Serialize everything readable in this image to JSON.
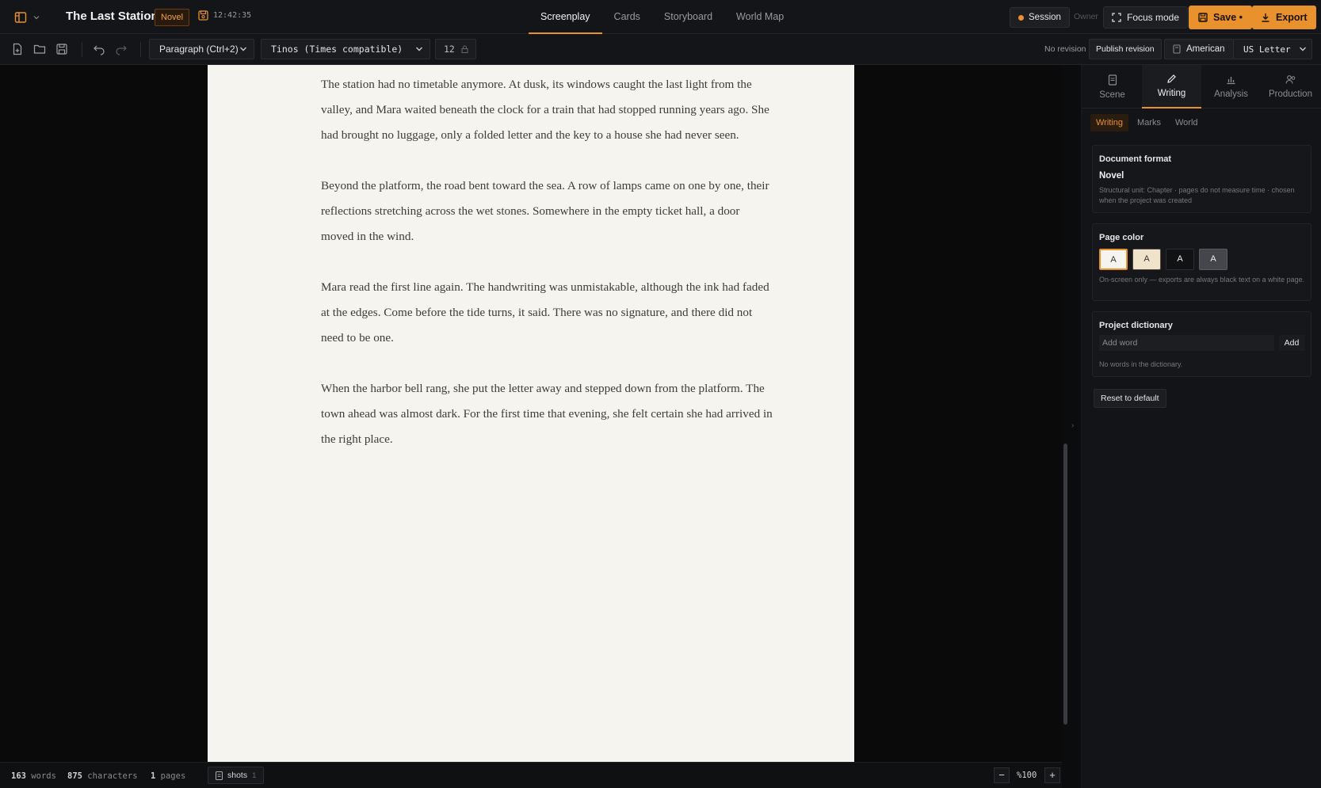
{
  "header": {
    "title": "The Last Station",
    "badge": "Novel",
    "saved_time": "12:42:35",
    "nav_tabs": [
      {
        "label": "Screenplay",
        "active": true
      },
      {
        "label": "Cards",
        "active": false
      },
      {
        "label": "Storyboard",
        "active": false
      },
      {
        "label": "World Map",
        "active": false
      }
    ],
    "session_label": "Session",
    "owner_label": "Owner",
    "focus_label": "Focus mode",
    "save_label": "Save •",
    "export_label": "Export",
    "accent_color": "#e8912d"
  },
  "toolbar": {
    "paragraph_style": "Paragraph (Ctrl+2)",
    "font": "Tinos (Times compatible)",
    "font_size": "12",
    "revision_status": "No revision",
    "publish_label": "Publish revision",
    "locale": "American",
    "paper_size": "US Letter"
  },
  "document": {
    "paragraphs": [
      "The station had no timetable anymore. At dusk, its windows caught the last light from the valley, and Mara waited beneath the clock for a train that had stopped running years ago. She had brought no luggage, only a folded letter and the key to a house she had never seen.",
      "Beyond the platform, the road bent toward the sea. A row of lamps came on one by one, their reflections stretching across the wet stones. Somewhere in the empty ticket hall, a door moved in the wind.",
      "Mara read the first line again. The handwriting was unmistakable, although the ink had faded at the edges. Come before the tide turns, it said. There was no signature, and there did not need to be one.",
      "When the harbor bell rang, she put the letter away and stepped down from the platform. The town ahead was almost dark. For the first time that evening, she felt certain she had arrived in the right place."
    ]
  },
  "status": {
    "words": "163",
    "words_label": "words",
    "characters": "875",
    "characters_label": "characters",
    "pages": "1",
    "pages_label": "pages",
    "shots_label": "shots",
    "shots_count": "1",
    "zoom": "%100"
  },
  "panel": {
    "tabs": [
      {
        "label": "Scene",
        "icon": "document-icon"
      },
      {
        "label": "Writing",
        "icon": "pencil-icon",
        "active": true
      },
      {
        "label": "Analysis",
        "icon": "bar-chart-icon"
      },
      {
        "label": "Production",
        "icon": "people-icon"
      }
    ],
    "subtabs": [
      {
        "label": "Writing",
        "active": true
      },
      {
        "label": "Marks"
      },
      {
        "label": "World"
      }
    ],
    "document_format": {
      "heading": "Document format",
      "value": "Novel",
      "hint": "Structural unit: Chapter · pages do not measure time · chosen when the project was created"
    },
    "page_color": {
      "heading": "Page color",
      "swatches": [
        {
          "label": "A",
          "bg": "#f6f4ef",
          "fg": "#333333",
          "selected": true
        },
        {
          "label": "A",
          "bg": "#efe3cc",
          "fg": "#333333"
        },
        {
          "label": "A",
          "bg": "#111214",
          "fg": "#eeeeee"
        },
        {
          "label": "A",
          "bg": "#45464b",
          "fg": "#eeeeee"
        }
      ],
      "hint": "On-screen only — exports are always black text on a white page."
    },
    "dictionary": {
      "heading": "Project dictionary",
      "placeholder": "Add word",
      "add_label": "Add",
      "empty_text": "No words in the dictionary."
    },
    "reset_label": "Reset to default"
  }
}
